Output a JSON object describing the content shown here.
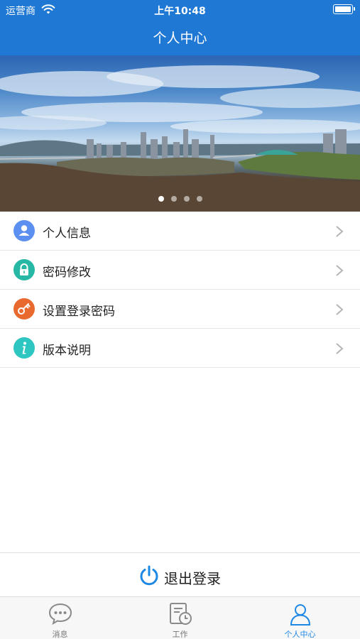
{
  "status_bar": {
    "carrier": "运营商",
    "time": "上午10:48"
  },
  "nav": {
    "title": "个人中心"
  },
  "banner": {
    "slide_count": 4,
    "active_index": 0
  },
  "menu": {
    "items": [
      {
        "label": "个人信息",
        "icon": "person-icon",
        "color": "#5b8ff0"
      },
      {
        "label": "密码修改",
        "icon": "lock-icon",
        "color": "#26b8a5"
      },
      {
        "label": "设置登录密码",
        "icon": "key-icon",
        "color": "#e86a2e"
      },
      {
        "label": "版本说明",
        "icon": "info-icon",
        "color": "#2ec6c0"
      }
    ]
  },
  "logout": {
    "label": "退出登录",
    "icon": "power-icon",
    "color": "#1e88e5"
  },
  "tabbar": {
    "tabs": [
      {
        "label": "消息",
        "icon": "message-icon",
        "active": false
      },
      {
        "label": "工作",
        "icon": "work-clock-icon",
        "active": false
      },
      {
        "label": "个人中心",
        "icon": "profile-icon",
        "active": true
      }
    ],
    "active_color": "#1e88e5"
  },
  "colors": {
    "primary": "#1e78d4",
    "divider": "#e6e6e6"
  }
}
